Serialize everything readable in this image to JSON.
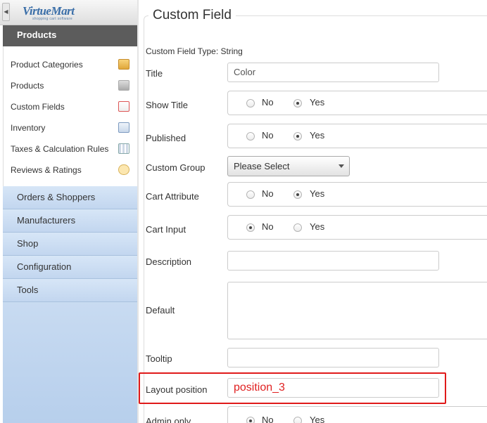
{
  "sidebar": {
    "logo_title": "VirtueMart",
    "logo_subtitle": "shopping cart software",
    "collapse_glyph": "◀",
    "products_header": "Products",
    "submenu": [
      {
        "label": "Product Categories",
        "icon": "category-folder-icon"
      },
      {
        "label": "Products",
        "icon": "camera-icon"
      },
      {
        "label": "Custom Fields",
        "icon": "custom-field-icon"
      },
      {
        "label": "Inventory",
        "icon": "inventory-chart-icon"
      },
      {
        "label": "Taxes & Calculation Rules",
        "icon": "calculator-icon"
      },
      {
        "label": "Reviews & Ratings",
        "icon": "speech-bubble-icon"
      }
    ],
    "menu": [
      "Orders & Shoppers",
      "Manufacturers",
      "Shop",
      "Configuration",
      "Tools"
    ]
  },
  "form": {
    "legend": "Custom Field",
    "custom_field_type": "Custom Field Type: String",
    "labels": {
      "title": "Title",
      "show_title": "Show Title",
      "published": "Published",
      "custom_group": "Custom Group",
      "cart_attribute": "Cart Attribute",
      "cart_input": "Cart Input",
      "description": "Description",
      "default": "Default",
      "tooltip": "Tooltip",
      "layout_position": "Layout position",
      "admin_only": "Admin only"
    },
    "values": {
      "title": "Color",
      "custom_group": "Please Select",
      "description": "",
      "default": "",
      "tooltip": "",
      "layout_position": "position_3"
    },
    "radio_no": "No",
    "radio_yes": "Yes",
    "radios": {
      "show_title": "Yes",
      "published": "Yes",
      "cart_attribute": "Yes",
      "cart_input": "No",
      "admin_only": "No"
    },
    "highlight_color": "#e01a1a"
  }
}
